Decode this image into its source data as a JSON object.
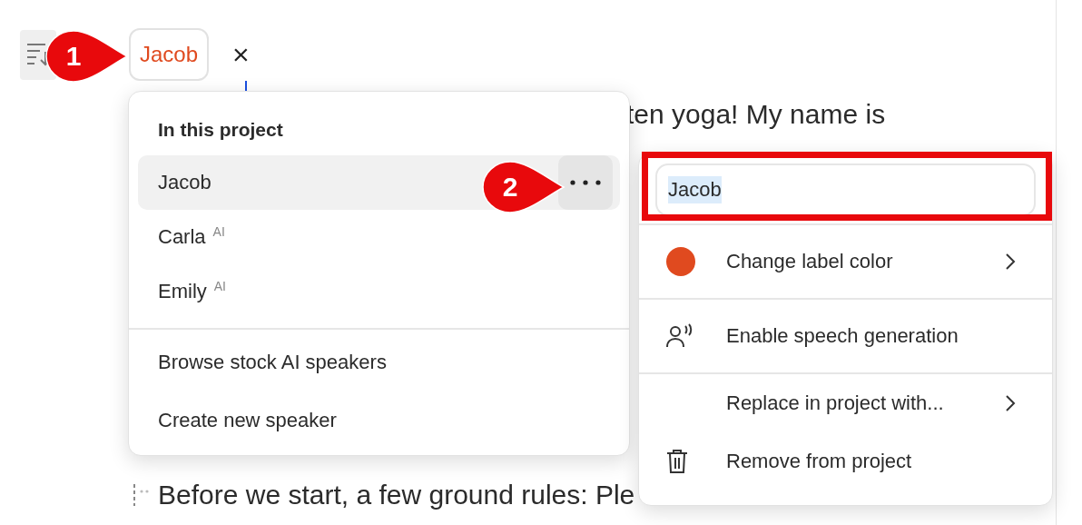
{
  "toolbar": {
    "speaker_tag": "Jacob",
    "close": "×"
  },
  "script_lines": [
    {
      "text": "ten yoga! My name is"
    },
    {
      "text": "Before we start, a few ground rules: Ple"
    }
  ],
  "speaker_menu": {
    "heading": "In this project",
    "speakers": [
      {
        "name": "Jacob",
        "selected": true
      },
      {
        "name": "Carla",
        "tag": "AI",
        "selected": false
      },
      {
        "name": "Emily",
        "tag": "AI",
        "selected": false
      }
    ],
    "actions": [
      "Browse stock AI speakers",
      "Create new speaker"
    ]
  },
  "speaker_options": {
    "name_field": {
      "value": "Jacob",
      "text_selected": true
    },
    "items": [
      {
        "kind": "color",
        "label": "Change label color",
        "submenu": true,
        "divider_after": true
      },
      {
        "kind": "voice",
        "label": "Enable speech generation",
        "submenu": false,
        "divider_after": true
      },
      {
        "kind": "plain",
        "label": "Replace in project with...",
        "submenu": true,
        "divider_after": false
      },
      {
        "kind": "delete",
        "label": "Remove from project",
        "submenu": false,
        "divider_after": false
      }
    ]
  },
  "callouts": [
    {
      "number": "1"
    },
    {
      "number": "2"
    }
  ]
}
